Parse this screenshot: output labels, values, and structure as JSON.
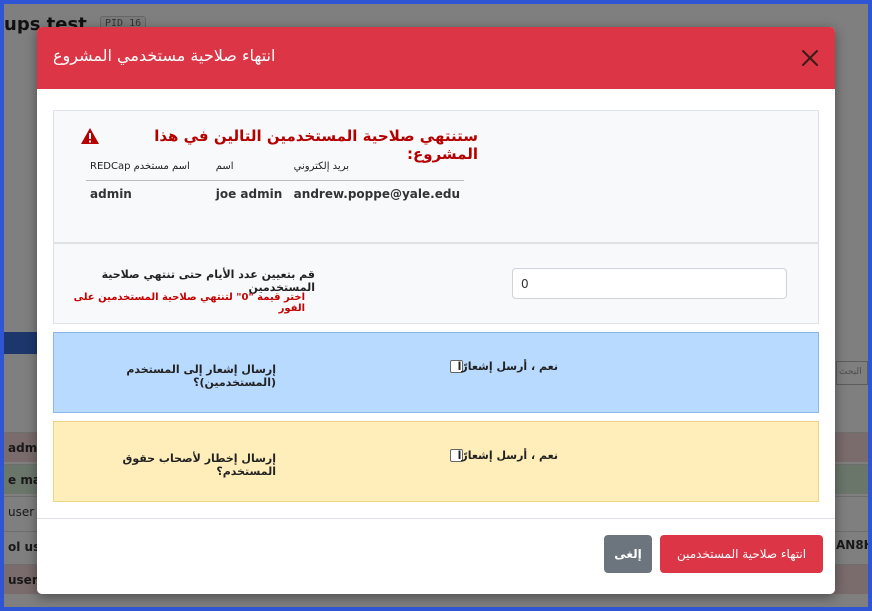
{
  "background": {
    "project_title": "ups test",
    "pid_badge": "PID 16",
    "rows": [
      "admi",
      "e ma",
      "user",
      "ol use",
      "user"
    ],
    "right_cell": "AN8H",
    "search_placeholder": "البحث"
  },
  "modal": {
    "title": "انتهاء صلاحية مستخدمي المشروع",
    "warning": "ستنتهي صلاحية المستخدمين التالين في هذا المشروع:",
    "table": {
      "headers": [
        "REDCap اسم مستخدم",
        "اسم",
        "بريد إلكتروني"
      ],
      "rows": [
        [
          "admin",
          "joe admin",
          "andrew.poppe@yale.edu"
        ]
      ]
    },
    "days": {
      "label": "قم بتعيين عدد الأيام حتى تنتهي صلاحية المستخدمين",
      "hint": "اختر قيمة \"0\" لتنتهي صلاحية المستخدمين على الفور",
      "value": "0"
    },
    "notify_users": {
      "question": "إرسال إشعار إلى المستخدم (المستخدمين)؟",
      "checkbox_label": "نعم ، أرسل إشعارًا",
      "checked": false
    },
    "notify_owners": {
      "question": "إرسال إخطار لأصحاب حقوق المستخدم؟",
      "checkbox_label": "نعم ، أرسل إشعارًا",
      "checked": false
    },
    "cancel_label": "إلغى",
    "expire_label": "انتهاء صلاحية المستخدمين"
  },
  "colors": {
    "danger": "#dc3545",
    "secondary": "#6c757d",
    "info_bg": "#b8daff",
    "warning_bg": "#ffeeba"
  }
}
